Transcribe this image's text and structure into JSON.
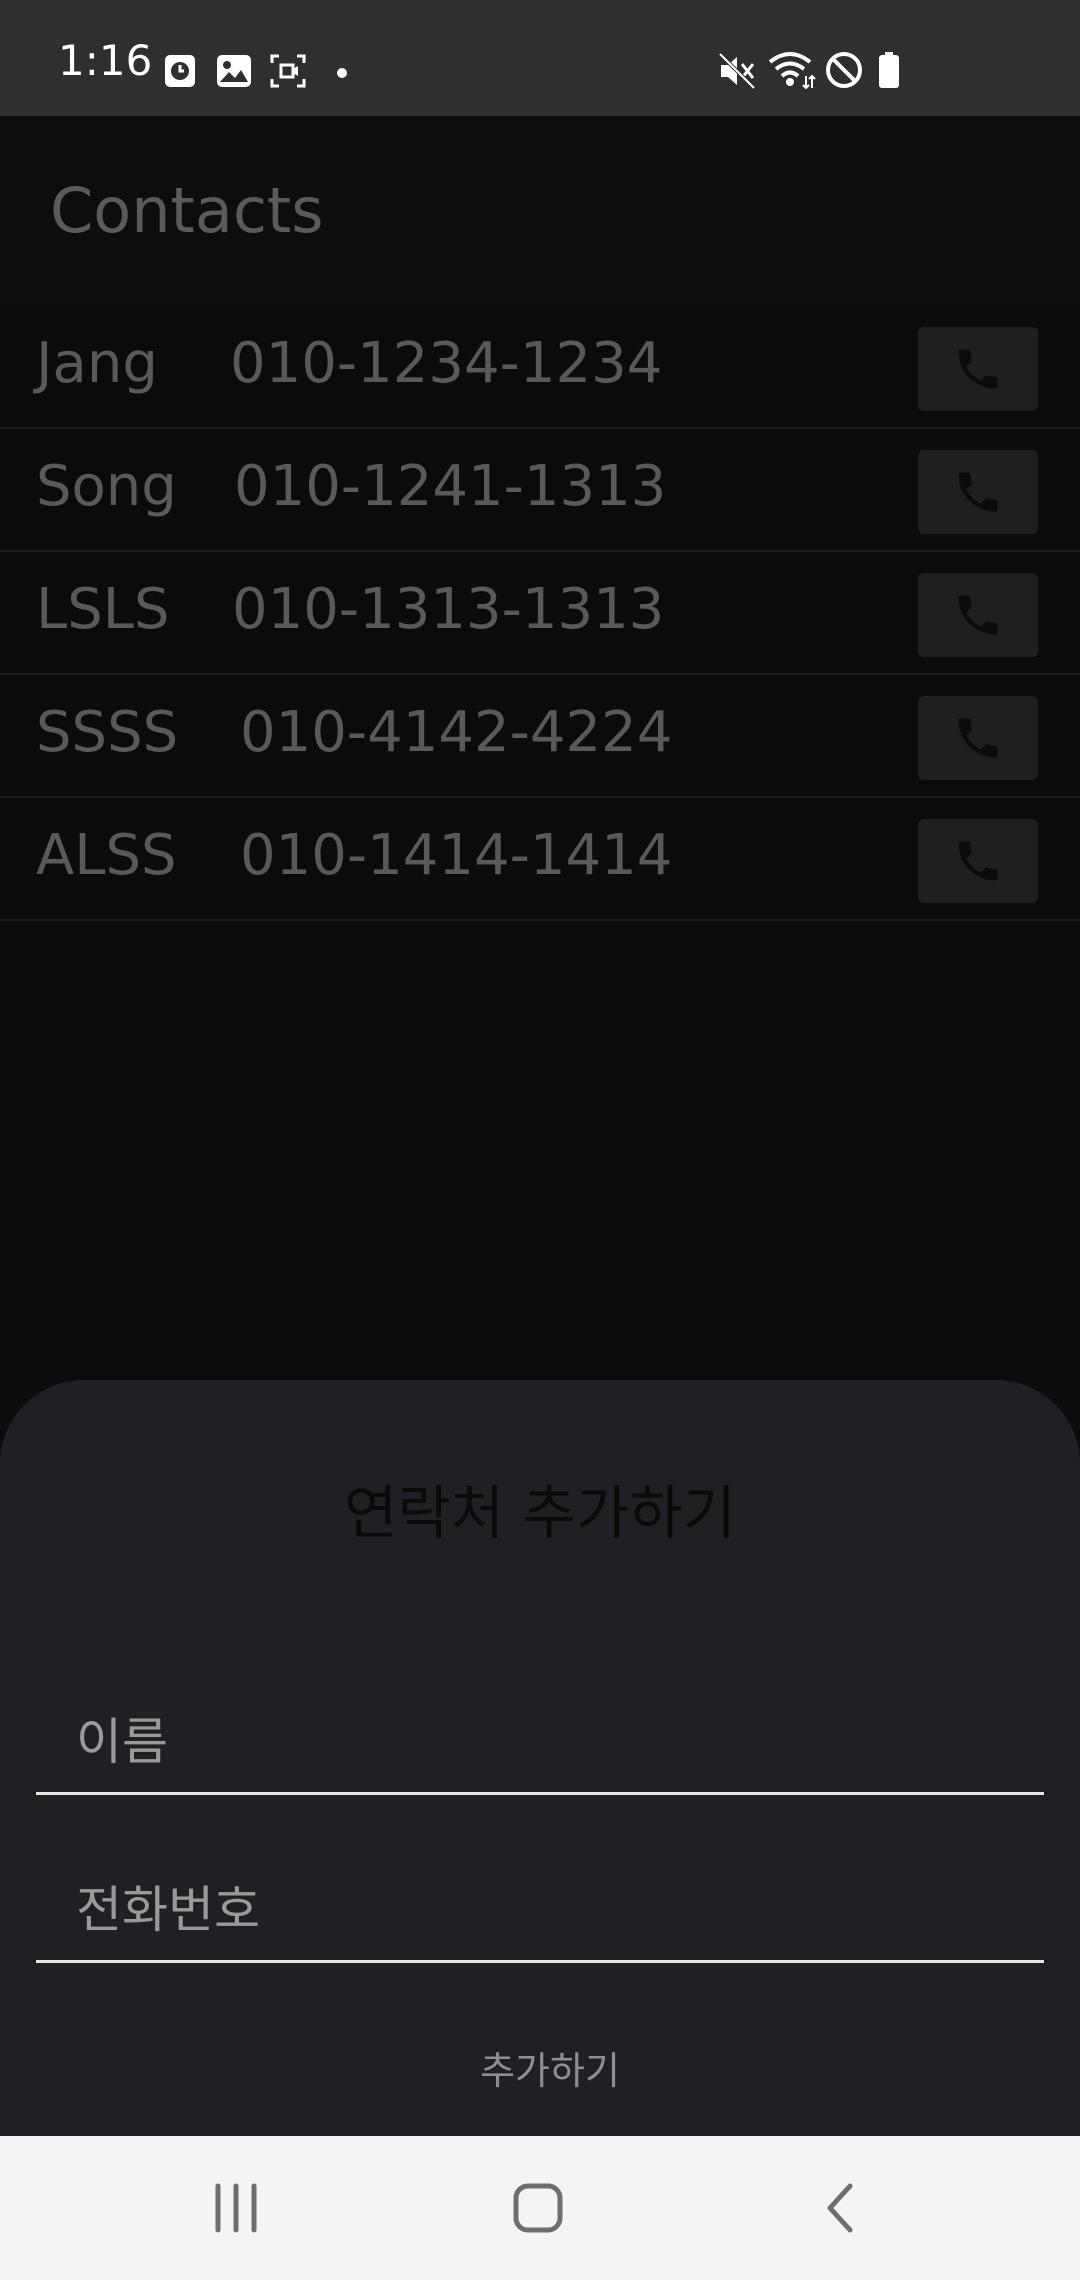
{
  "status_bar": {
    "time": "1:16",
    "left_icons": [
      "alarm-icon",
      "gallery-icon",
      "screenshot-icon",
      "notification-dot-icon"
    ],
    "right_icons": [
      "mute-icon",
      "wifi-icon",
      "do-not-disturb-icon",
      "battery-icon"
    ]
  },
  "app_bar": {
    "title": "Contacts"
  },
  "contacts": [
    {
      "name": "Jang",
      "phone": "010-1234-1234"
    },
    {
      "name": "Song",
      "phone": "010-1241-1313"
    },
    {
      "name": "LSLS",
      "phone": "010-1313-1313"
    },
    {
      "name": "SSSS",
      "phone": "010-4142-4224"
    },
    {
      "name": "ALSS",
      "phone": "010-1414-1414"
    }
  ],
  "call_icon": "phone-icon",
  "sheet": {
    "title": "연락처 추가하기",
    "name_field": {
      "value": "",
      "placeholder": "이름"
    },
    "phone_field": {
      "value": "",
      "placeholder": "전화번호"
    },
    "add_button_label": "추가하기"
  },
  "nav_bar": {
    "icons": [
      "recent-apps-icon",
      "home-icon",
      "back-icon"
    ]
  },
  "colors": {
    "status_bar_bg": "#2f2f31",
    "screen_bg": "#0c0c0d",
    "sheet_bg": "#202024",
    "nav_bar_bg": "#f4f4f4"
  }
}
